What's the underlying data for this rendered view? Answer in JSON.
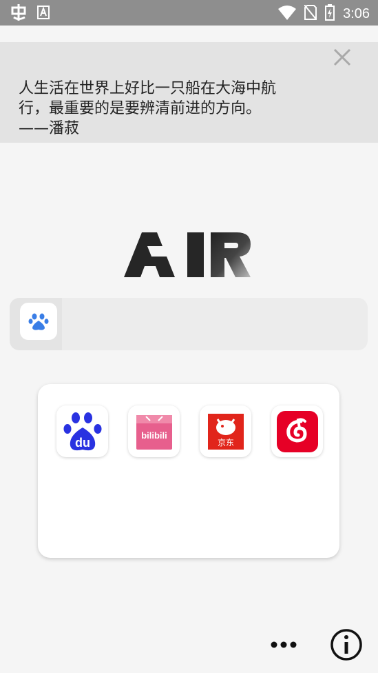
{
  "status_bar": {
    "time": "3:06",
    "colors": {
      "background": "#8e8e8e",
      "foreground": "#ffffff"
    },
    "icons": [
      "bug-icon",
      "font-icon",
      "wifi-icon",
      "no-sim-icon",
      "battery-charging-icon"
    ]
  },
  "quote": {
    "line1": "人生活在世界上好比一只船在大海中航",
    "line2": "行，最重要的是要辨清前进的方向。",
    "author": "——潘菽"
  },
  "logo": {
    "text": "AIR"
  },
  "search": {
    "engine": "baidu",
    "value": "",
    "placeholder": ""
  },
  "shortcuts": [
    {
      "name": "baidu",
      "icon": "baidu-paw-icon",
      "color": "#2932e1"
    },
    {
      "name": "bilibili",
      "icon": "bilibili-tv-icon",
      "color": "#e75f8d"
    },
    {
      "name": "jd",
      "icon": "jd-dog-icon",
      "color": "#e1251b"
    },
    {
      "name": "netease-music",
      "icon": "netease-music-icon",
      "color": "#e60026"
    }
  ],
  "bottom_bar": {
    "more_icon": "more-dots-icon",
    "info_icon": "info-icon"
  }
}
